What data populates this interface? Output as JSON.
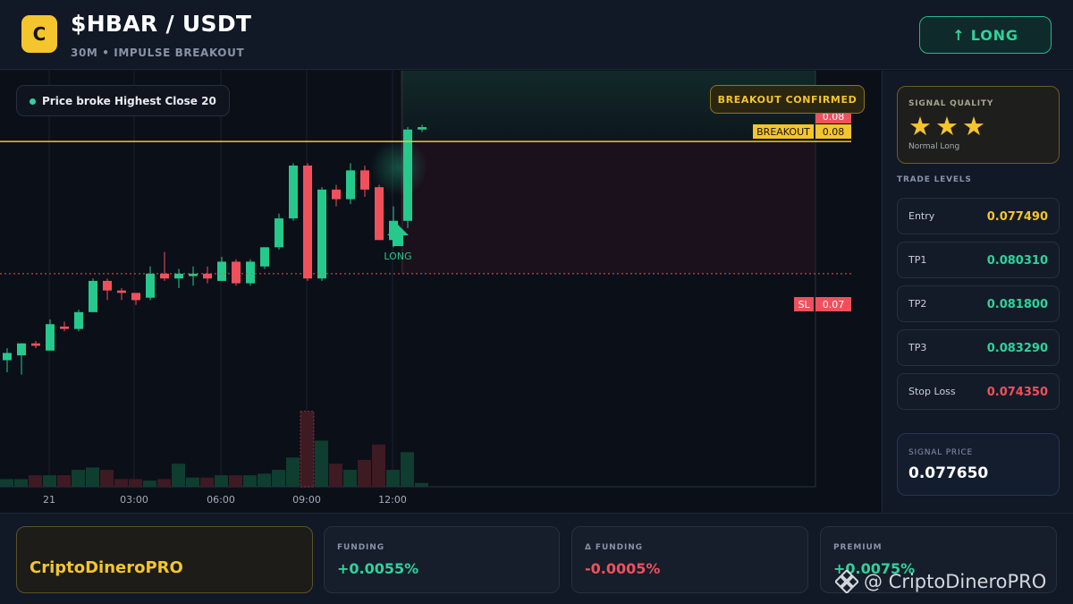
{
  "header": {
    "logo_letter": "C",
    "title": "$HBAR / USDT",
    "subtitle": "30M • IMPULSE BREAKOUT",
    "signal_button": "↑ LONG",
    "signal_color": "#2ed39a"
  },
  "chart": {
    "condition_text": "Price broke Highest Close 20",
    "badge_text": "BREAKOUT CONFIRMED",
    "breakout_label": "BREAKOUT",
    "breakout_price": "0.08",
    "current_price": "0.08",
    "sl_label": "SL",
    "sl_price": "0.07",
    "long_marker": "LONG",
    "tv_logo": "TV",
    "xticks": [
      "21",
      "03:00",
      "06:00",
      "09:00",
      "12:00"
    ],
    "colors": {
      "up": "#26c98c",
      "down": "#f0505c",
      "breakout_line": "#f4c52c",
      "sl_line": "#f0505c"
    }
  },
  "chart_data": {
    "type": "candlestick",
    "candles": [
      {
        "o": 0.0708,
        "h": 0.0713,
        "l": 0.0703,
        "c": 0.0711
      },
      {
        "o": 0.071,
        "h": 0.0715,
        "l": 0.0702,
        "c": 0.0715
      },
      {
        "o": 0.0715,
        "h": 0.0716,
        "l": 0.0713,
        "c": 0.0714
      },
      {
        "o": 0.0712,
        "h": 0.0725,
        "l": 0.0712,
        "c": 0.0723
      },
      {
        "o": 0.0722,
        "h": 0.0724,
        "l": 0.072,
        "c": 0.0721
      },
      {
        "o": 0.0721,
        "h": 0.0729,
        "l": 0.072,
        "c": 0.0728
      },
      {
        "o": 0.0728,
        "h": 0.0742,
        "l": 0.0728,
        "c": 0.0741
      },
      {
        "o": 0.0741,
        "h": 0.0742,
        "l": 0.0733,
        "c": 0.0737
      },
      {
        "o": 0.0737,
        "h": 0.0738,
        "l": 0.0733,
        "c": 0.0736
      },
      {
        "o": 0.0736,
        "h": 0.0734,
        "l": 0.0731,
        "c": 0.0733
      },
      {
        "o": 0.0734,
        "h": 0.0747,
        "l": 0.0733,
        "c": 0.0744
      },
      {
        "o": 0.0744,
        "h": 0.0753,
        "l": 0.0741,
        "c": 0.0742
      },
      {
        "o": 0.0742,
        "h": 0.0746,
        "l": 0.0738,
        "c": 0.0744
      },
      {
        "o": 0.0743,
        "h": 0.0747,
        "l": 0.0739,
        "c": 0.0744
      },
      {
        "o": 0.0744,
        "h": 0.0747,
        "l": 0.074,
        "c": 0.0742
      },
      {
        "o": 0.0741,
        "h": 0.0751,
        "l": 0.0741,
        "c": 0.0749
      },
      {
        "o": 0.0749,
        "h": 0.075,
        "l": 0.0739,
        "c": 0.074
      },
      {
        "o": 0.074,
        "h": 0.075,
        "l": 0.0739,
        "c": 0.0749
      },
      {
        "o": 0.0747,
        "h": 0.0755,
        "l": 0.0746,
        "c": 0.0755
      },
      {
        "o": 0.0755,
        "h": 0.0769,
        "l": 0.0754,
        "c": 0.0767
      },
      {
        "o": 0.0767,
        "h": 0.079,
        "l": 0.0766,
        "c": 0.0789
      },
      {
        "o": 0.0789,
        "h": 0.079,
        "l": 0.0741,
        "c": 0.0742
      },
      {
        "o": 0.0742,
        "h": 0.078,
        "l": 0.0741,
        "c": 0.0779
      },
      {
        "o": 0.0779,
        "h": 0.0781,
        "l": 0.0772,
        "c": 0.0775
      },
      {
        "o": 0.0775,
        "h": 0.079,
        "l": 0.0773,
        "c": 0.0787
      },
      {
        "o": 0.0787,
        "h": 0.0789,
        "l": 0.0776,
        "c": 0.0779
      },
      {
        "o": 0.078,
        "h": 0.0781,
        "l": 0.0758,
        "c": 0.0758
      },
      {
        "o": 0.0758,
        "h": 0.0772,
        "l": 0.0755,
        "c": 0.0766
      },
      {
        "o": 0.0766,
        "h": 0.0805,
        "l": 0.0763,
        "c": 0.0804
      },
      {
        "o": 0.0804,
        "h": 0.0806,
        "l": 0.0803,
        "c": 0.0805
      }
    ],
    "volume": [
      10,
      10,
      15,
      15,
      15,
      22,
      25,
      22,
      10,
      10,
      8,
      10,
      30,
      12,
      12,
      15,
      15,
      15,
      17,
      22,
      38,
      98,
      60,
      30,
      22,
      35,
      55,
      22,
      45,
      5
    ],
    "breakout_level": 0.0799,
    "stop_loss_level": 0.0744,
    "signal_candle_index": 28
  },
  "panel": {
    "quality_label": "SIGNAL QUALITY",
    "stars": "★★★",
    "quality_rating": 3,
    "quality_max": 3,
    "quality_text": "Normal Long",
    "trade_levels_label": "TRADE LEVELS",
    "levels": [
      {
        "name": "Entry",
        "value": "0.077490",
        "color": "#f4c52c"
      },
      {
        "name": "TP1",
        "value": "0.080310",
        "color": "#2ed39a"
      },
      {
        "name": "TP2",
        "value": "0.081800",
        "color": "#2ed39a"
      },
      {
        "name": "TP3",
        "value": "0.083290",
        "color": "#2ed39a"
      },
      {
        "name": "Stop Loss",
        "value": "0.074350",
        "color": "#f0505c"
      }
    ],
    "signal_price_label": "SIGNAL PRICE",
    "signal_price": "0.077650"
  },
  "footer": {
    "brand": "CriptoDineroPRO",
    "cards": [
      {
        "label": "FUNDING",
        "value": "+0.0055%",
        "color": "#2ed39a"
      },
      {
        "label": "Δ FUNDING",
        "value": "-0.0005%",
        "color": "#f0505c"
      },
      {
        "label": "PREMIUM",
        "value": "+0.0075%",
        "color": "#2ed39a"
      }
    ],
    "watermark": "@ CriptoDineroPRO"
  }
}
